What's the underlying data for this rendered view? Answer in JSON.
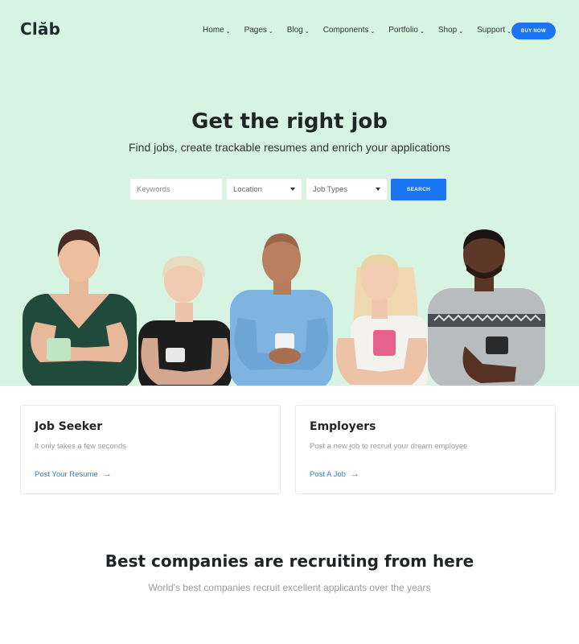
{
  "brand": {
    "logo_text": "Clăb"
  },
  "nav": {
    "items": [
      {
        "label": "Home"
      },
      {
        "label": "Pages"
      },
      {
        "label": "Blog"
      },
      {
        "label": "Components"
      },
      {
        "label": "Portfolio"
      },
      {
        "label": "Shop"
      },
      {
        "label": "Support"
      }
    ],
    "cta_label": "BUY NOW"
  },
  "hero": {
    "title": "Get the right job",
    "subtitle": "Find jobs, create trackable resumes and enrich your applications"
  },
  "search": {
    "keywords_placeholder": "Keywords",
    "location_value": "Location",
    "job_types_value": "Job Types",
    "button_label": "SEARCH"
  },
  "cards": [
    {
      "title": "Job Seeker",
      "text": "It only takes a few seconds",
      "link": "Post Your Resume"
    },
    {
      "title": "Employers",
      "text": "Post a new job to recruit your dream employee",
      "link": "Post A Job"
    }
  ],
  "companies": {
    "title": "Best companies are recruiting from here",
    "subtitle": "World's best companies recruit excellent applicants over the years"
  },
  "colors": {
    "hero_bg": "#d7f4e3",
    "accent": "#1b74f0",
    "link": "#2b7be6"
  }
}
